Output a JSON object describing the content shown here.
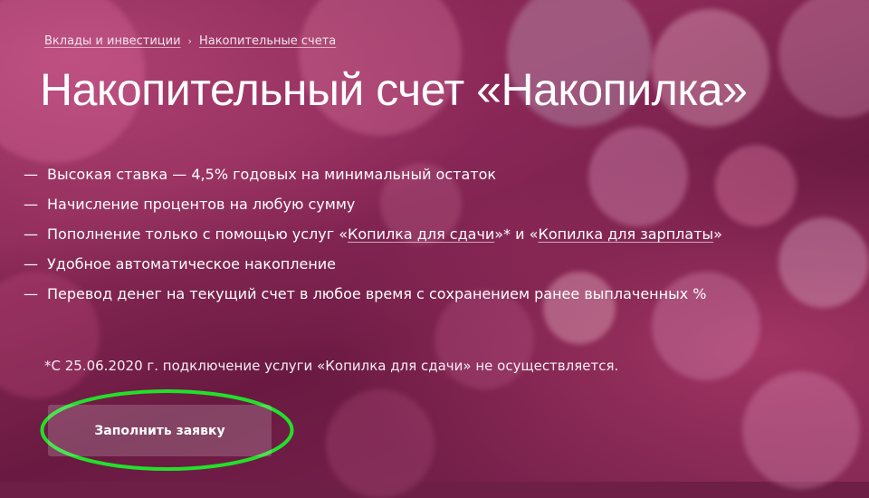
{
  "breadcrumb": {
    "items": [
      {
        "label": "Вклады и инвестиции"
      },
      {
        "label": "Накопительные счета"
      }
    ],
    "separator": "›"
  },
  "title": "Накопительный счет «Накопилка»",
  "features": {
    "dash": "—",
    "items": [
      {
        "text": "Высокая ставка — 4,5% годовых на минимальный остаток"
      },
      {
        "text": "Начисление процентов на любую сумму"
      },
      {
        "text_before": "Пополнение только с помощью услуг «",
        "link1": "Копилка для сдачи",
        "text_middle": "»* и «",
        "link2": "Копилка для зарплаты",
        "text_after": "»"
      },
      {
        "text": "Удобное автоматическое накопление"
      },
      {
        "text": "Перевод денег на текущий счет в любое время с сохранением ранее выплаченных %"
      }
    ]
  },
  "note": "*С 25.06.2020 г. подключение услуги «Копилка для сдачи» не осуществляется.",
  "cta": {
    "label": "Заполнить заявку",
    "highlight_color": "#22e02a"
  },
  "colors": {
    "background": "#7a1f4a",
    "text": "#ffffff"
  }
}
